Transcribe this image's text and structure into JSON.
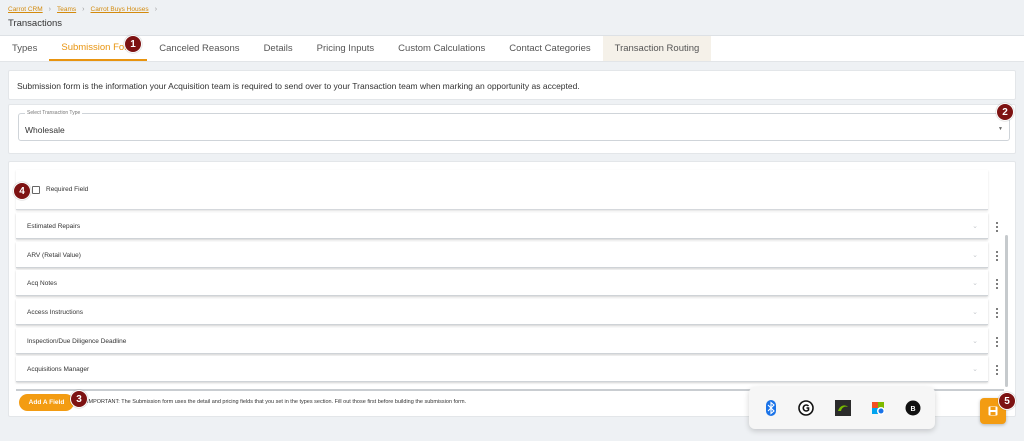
{
  "breadcrumb": [
    "Carrot CRM",
    "Teams",
    "Carrot Buys Houses"
  ],
  "breadcrumb_separator": "›",
  "page_title": "Transactions",
  "tabs": [
    "Types",
    "Submission Form",
    "Canceled Reasons",
    "Details",
    "Pricing Inputs",
    "Custom Calculations",
    "Contact Categories",
    "Transaction Routing"
  ],
  "active_tab": "Submission Form",
  "description": "Submission form is the information your Acquisition team is required to send over to your Transaction team when marking an opportunity as accepted.",
  "transaction_type": {
    "label": "Select Transaction Type",
    "value": "Wholesale",
    "arrow": "▼"
  },
  "required_field_label": "Required Field",
  "fields": [
    "Estimated Repairs",
    "ARV (Retail Value)",
    "Acq Notes",
    "Access Instructions",
    "Inspection/Due Diligence Deadline",
    "Acquisitions Manager"
  ],
  "add_field_button": "Add A Field",
  "note": "IMPORTANT: The Submission form uses the detail and pricing fields that you set in the types section. Fill out those first before building the submission form.",
  "callouts": [
    "1",
    "2",
    "3",
    "4",
    "5"
  ],
  "tray_icons": [
    "bluetooth-icon",
    "grammarly-icon",
    "nvidia-icon",
    "onedrive-icon",
    "app-icon"
  ],
  "colors": {
    "accent": "#f39c12",
    "link": "#d38a0c",
    "callout": "#7d1212"
  }
}
